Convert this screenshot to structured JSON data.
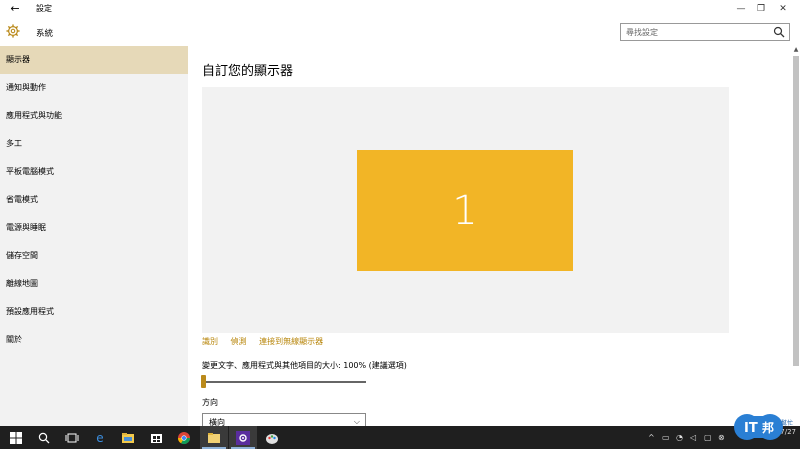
{
  "window": {
    "title": "設定",
    "back_glyph": "←",
    "min_glyph": "—",
    "max_glyph": "❐",
    "close_glyph": "✕"
  },
  "header": {
    "section_title": "系統",
    "search_placeholder": "尋找設定"
  },
  "sidebar": {
    "items": [
      {
        "label": "顯示器",
        "active": true
      },
      {
        "label": "通知與動作"
      },
      {
        "label": "應用程式與功能"
      },
      {
        "label": "多工"
      },
      {
        "label": "平板電腦模式"
      },
      {
        "label": "省電模式"
      },
      {
        "label": "電源與睡眠"
      },
      {
        "label": "儲存空間"
      },
      {
        "label": "離線地圖"
      },
      {
        "label": "預設應用程式"
      },
      {
        "label": "關於"
      }
    ]
  },
  "main": {
    "title": "自訂您的顯示器",
    "monitor_number": "1",
    "links": [
      "識別",
      "偵測",
      "連接到無線顯示器"
    ],
    "scale_label": "變更文字、應用程式與其他項目的大小: 100% (建議選項)",
    "scale_value": 0,
    "orientation_label": "方向",
    "orientation_value": "橫向"
  },
  "taskbar": {
    "clock_time": "",
    "clock_date": "2015/7/27"
  },
  "colors": {
    "accent": "#ba8a1b",
    "monitor": "#f2b526",
    "sidebar_bg": "#f2f2f2",
    "sidebar_active": "#e6d9b8",
    "taskbar": "#1f1f1f"
  },
  "icons": {
    "back": "back-arrow-icon",
    "settings": "gear-icon",
    "search": "search-icon",
    "start": "windows-start-icon",
    "cortana": "search-icon",
    "task_view": "task-view-icon",
    "edge": "edge-icon",
    "explorer": "file-explorer-icon",
    "store": "store-icon",
    "chrome": "chrome-icon",
    "folder": "folder-icon",
    "settings_app": "settings-app-icon",
    "paint": "paint-icon"
  }
}
